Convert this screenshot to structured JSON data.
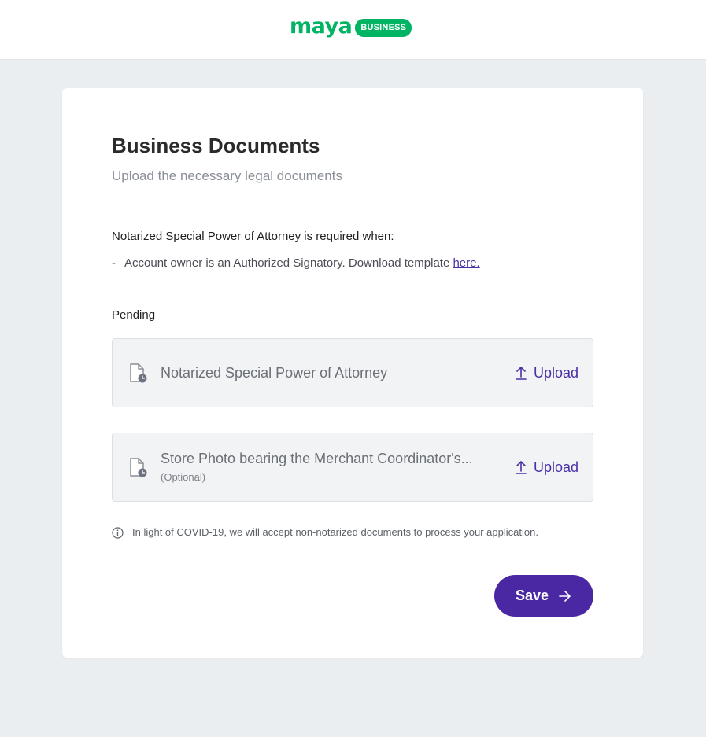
{
  "brand": {
    "wordmark": "maya",
    "badge": "BUSINESS",
    "color": "#00b464"
  },
  "page": {
    "title": "Business Documents",
    "subtitle": "Upload the necessary legal documents"
  },
  "requirements": {
    "heading": "Notarized Special Power of Attorney is required when:",
    "dash": "-",
    "item_text": "Account owner is an Authorized Signatory. Download template ",
    "link_text": "here."
  },
  "pending": {
    "label": "Pending",
    "documents": [
      {
        "name": "Notarized Special Power of Attorney",
        "sub": "",
        "icon": "document-pending-icon",
        "action": "Upload"
      },
      {
        "name": "Store Photo bearing the Merchant Coordinator's...",
        "sub": "(Optional)",
        "icon": "document-pending-icon",
        "action": "Upload"
      }
    ]
  },
  "note": {
    "icon": "info-icon",
    "text": "In light of COVID-19, we will accept non-notarized documents to process your application."
  },
  "actions": {
    "save_label": "Save",
    "save_icon": "arrow-right-icon",
    "accent": "#4a28a4"
  }
}
